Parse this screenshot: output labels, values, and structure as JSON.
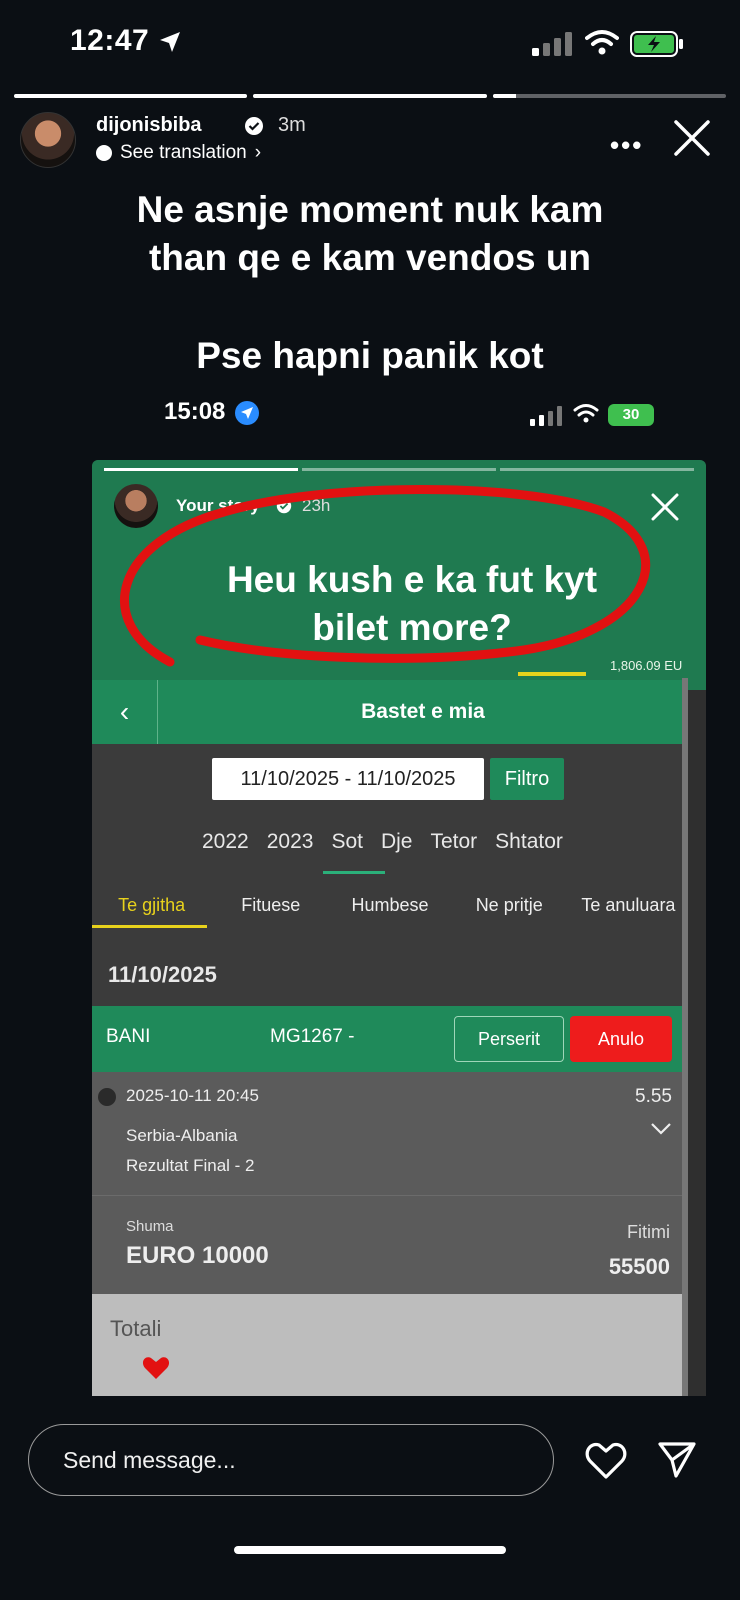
{
  "status_bar": {
    "time": "12:47"
  },
  "story": {
    "progress": [
      1,
      1,
      0.1
    ],
    "username": "dijonisbiba",
    "posted_ago": "3m",
    "see_translation": "See translation",
    "more": "•••",
    "caption_lines": [
      "Ne asnje moment nuk kam",
      "than qe e kam vendos un"
    ],
    "caption2": "Pse hapni panik kot"
  },
  "inner_status": {
    "time": "15:08",
    "battery": "30"
  },
  "inner_story": {
    "label": "Your story",
    "posted_ago": "23h",
    "caption_lines": [
      "Heu kush e ka fut kyt",
      "bilet more?"
    ],
    "balance": "1,806.09 EU"
  },
  "betting": {
    "title": "Bastet e mia",
    "date_range": "11/10/2025 - 11/10/2025",
    "filter_btn": "Filtro",
    "periods": [
      "2022",
      "2023",
      "Sot",
      "Dje",
      "Tetor",
      "Shtator"
    ],
    "active_period": "Sot",
    "tabs": [
      "Te gjitha",
      "Fituese",
      "Humbese",
      "Ne pritje",
      "Te anuluara"
    ],
    "day": "11/10/2025",
    "bet": {
      "status": "BANI",
      "code": "MG1267 -",
      "repeat_btn": "Perserit",
      "cancel_btn": "Anulo",
      "datetime": "2025-10-11 20:45",
      "odds": "5.55",
      "match": "Serbia-Albania",
      "market": "Rezultat Final - 2",
      "stake_label": "Shuma",
      "stake": "EURO 10000",
      "win_label": "Fitimi",
      "win": "55500"
    },
    "total_label": "Totali"
  },
  "footer": {
    "message_placeholder": "Send message..."
  },
  "colors": {
    "green": "#1f8a5a",
    "red_circle": "#e21111",
    "cancel": "#ee1c1c"
  }
}
